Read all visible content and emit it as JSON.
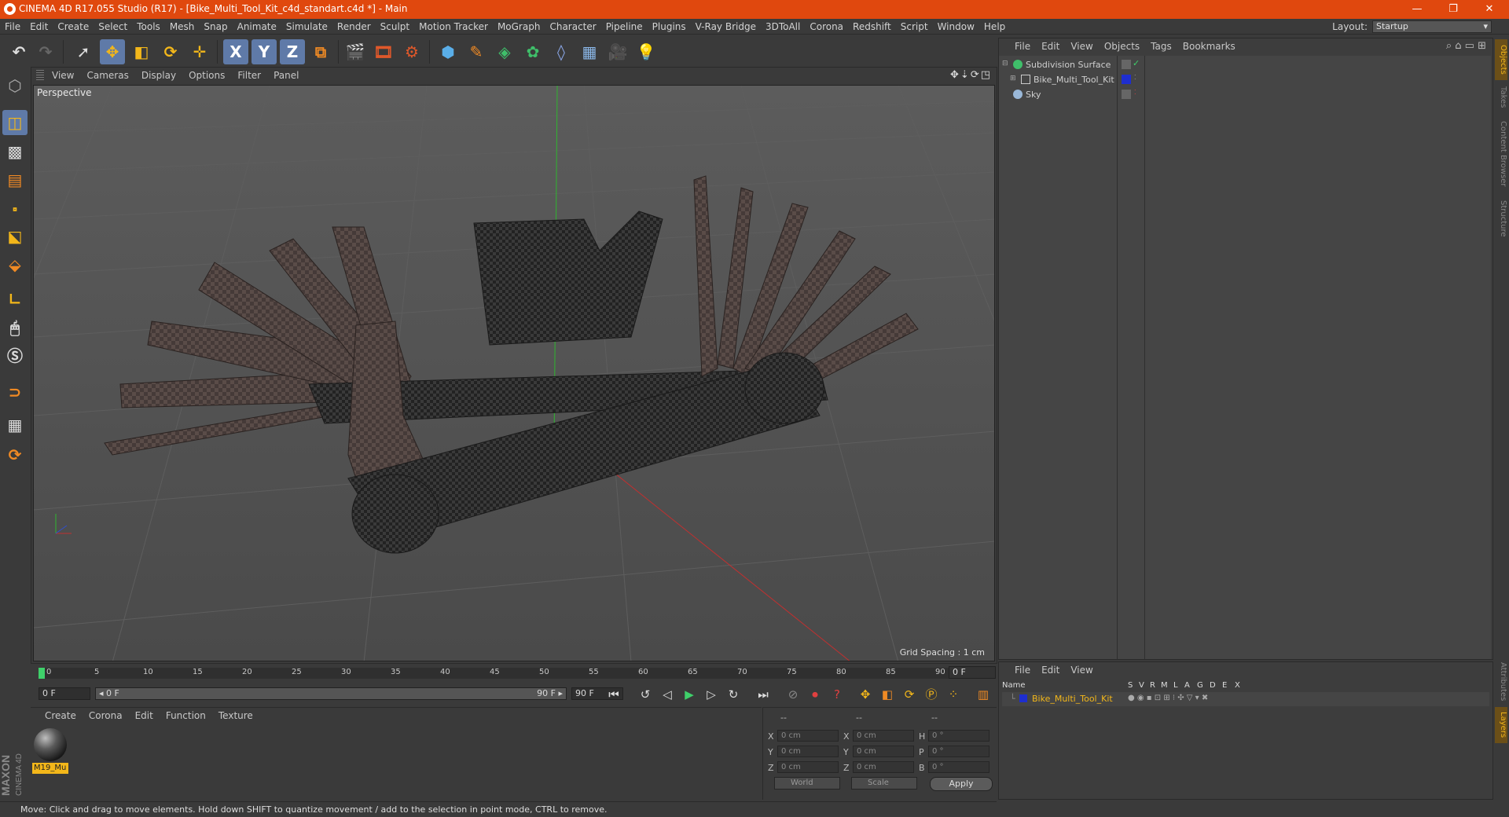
{
  "window": {
    "title": "CINEMA 4D R17.055 Studio (R17) - [Bike_Multi_Tool_Kit_c4d_standart.c4d *] - Main",
    "controls": [
      "—",
      "❐",
      "✕"
    ]
  },
  "menubar": {
    "items": [
      "File",
      "Edit",
      "Create",
      "Select",
      "Tools",
      "Mesh",
      "Snap",
      "Animate",
      "Simulate",
      "Render",
      "Sculpt",
      "Motion Tracker",
      "MoGraph",
      "Character",
      "Pipeline",
      "Plugins",
      "V-Ray Bridge",
      "3DToAll",
      "Corona",
      "Redshift",
      "Script",
      "Window",
      "Help"
    ],
    "layout_label": "Layout:",
    "layout_value": "Startup"
  },
  "toolbar": {
    "axis_x": "X",
    "axis_y": "Y",
    "axis_z": "Z"
  },
  "viewport": {
    "menu": [
      "View",
      "Cameras",
      "Display",
      "Options",
      "Filter",
      "Panel"
    ],
    "nav_icons": "✥⇣⟳◳",
    "label": "Perspective",
    "grid_spacing": "Grid Spacing : 1 cm"
  },
  "timeline": {
    "ticks": [
      "0",
      "5",
      "10",
      "15",
      "20",
      "25",
      "30",
      "35",
      "40",
      "45",
      "50",
      "55",
      "60",
      "65",
      "70",
      "75",
      "80",
      "85",
      "90"
    ],
    "current_frame": "0 F"
  },
  "transport": {
    "start_field": "0 F",
    "range_start": "◂ 0 F",
    "range_end": "90 F ▸",
    "end_field": "90 F"
  },
  "material_manager": {
    "menu": [
      "Create",
      "Corona",
      "Edit",
      "Function",
      "Texture"
    ],
    "materials": [
      {
        "name": "M19_Mu"
      }
    ]
  },
  "coordinates": {
    "header": [
      "--",
      "--",
      "--"
    ],
    "rows": [
      {
        "l1": "X",
        "v1": "0 cm",
        "l2": "X",
        "v2": "0 cm",
        "l3": "H",
        "v3": "0 °"
      },
      {
        "l1": "Y",
        "v1": "0 cm",
        "l2": "Y",
        "v2": "0 cm",
        "l3": "P",
        "v3": "0 °"
      },
      {
        "l1": "Z",
        "v1": "0 cm",
        "l2": "Z",
        "v2": "0 cm",
        "l3": "B",
        "v3": "0 °"
      }
    ],
    "mode_world": "World",
    "mode_scale": "Scale",
    "apply_label": "Apply"
  },
  "object_manager": {
    "menu": [
      "File",
      "Edit",
      "View",
      "Objects",
      "Tags",
      "Bookmarks"
    ],
    "objects": [
      {
        "name": "Subdivision Surface",
        "icon_color": "#3fbf6a"
      },
      {
        "name": "Bike_Multi_Tool_Kit",
        "icon_color": "#8a8a8a",
        "layer_color": "#1e2ecf"
      },
      {
        "name": "Sky",
        "icon_color": "#9ab8d8"
      }
    ]
  },
  "side_tabs": [
    "Objects",
    "Takes",
    "Content Browser",
    "Structure",
    "Attributes",
    "Layers"
  ],
  "layer_manager": {
    "menu": [
      "File",
      "Edit",
      "View"
    ],
    "columns": [
      "Name",
      "S",
      "V",
      "R",
      "M",
      "L",
      "A",
      "G",
      "D",
      "E",
      "X"
    ],
    "layers": [
      {
        "name": "Bike_Multi_Tool_Kit",
        "color": "#1e2ecf"
      }
    ]
  },
  "status": {
    "text": "Move: Click and drag to move elements. Hold down SHIFT to quantize movement / add to the selection in point mode, CTRL to remove."
  },
  "colors": {
    "titlebar": "#e0480e",
    "selection": "#5f7aa8",
    "accent": "#f3b71a"
  }
}
